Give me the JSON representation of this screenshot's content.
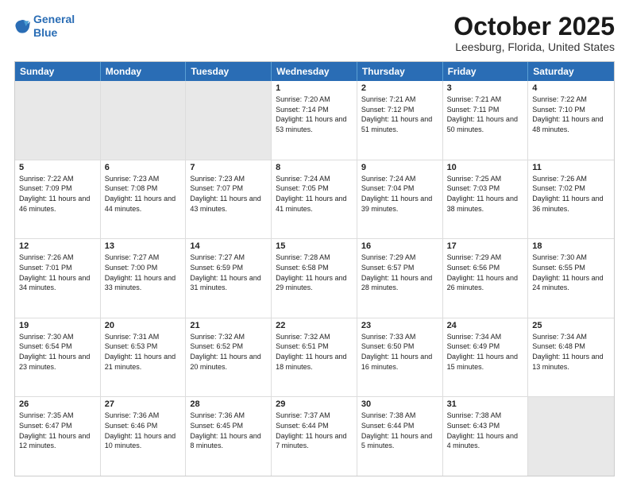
{
  "logo": {
    "line1": "General",
    "line2": "Blue"
  },
  "title": "October 2025",
  "location": "Leesburg, Florida, United States",
  "days_of_week": [
    "Sunday",
    "Monday",
    "Tuesday",
    "Wednesday",
    "Thursday",
    "Friday",
    "Saturday"
  ],
  "rows": [
    [
      {
        "day": "",
        "text": ""
      },
      {
        "day": "",
        "text": ""
      },
      {
        "day": "",
        "text": ""
      },
      {
        "day": "1",
        "text": "Sunrise: 7:20 AM\nSunset: 7:14 PM\nDaylight: 11 hours and 53 minutes."
      },
      {
        "day": "2",
        "text": "Sunrise: 7:21 AM\nSunset: 7:12 PM\nDaylight: 11 hours and 51 minutes."
      },
      {
        "day": "3",
        "text": "Sunrise: 7:21 AM\nSunset: 7:11 PM\nDaylight: 11 hours and 50 minutes."
      },
      {
        "day": "4",
        "text": "Sunrise: 7:22 AM\nSunset: 7:10 PM\nDaylight: 11 hours and 48 minutes."
      }
    ],
    [
      {
        "day": "5",
        "text": "Sunrise: 7:22 AM\nSunset: 7:09 PM\nDaylight: 11 hours and 46 minutes."
      },
      {
        "day": "6",
        "text": "Sunrise: 7:23 AM\nSunset: 7:08 PM\nDaylight: 11 hours and 44 minutes."
      },
      {
        "day": "7",
        "text": "Sunrise: 7:23 AM\nSunset: 7:07 PM\nDaylight: 11 hours and 43 minutes."
      },
      {
        "day": "8",
        "text": "Sunrise: 7:24 AM\nSunset: 7:05 PM\nDaylight: 11 hours and 41 minutes."
      },
      {
        "day": "9",
        "text": "Sunrise: 7:24 AM\nSunset: 7:04 PM\nDaylight: 11 hours and 39 minutes."
      },
      {
        "day": "10",
        "text": "Sunrise: 7:25 AM\nSunset: 7:03 PM\nDaylight: 11 hours and 38 minutes."
      },
      {
        "day": "11",
        "text": "Sunrise: 7:26 AM\nSunset: 7:02 PM\nDaylight: 11 hours and 36 minutes."
      }
    ],
    [
      {
        "day": "12",
        "text": "Sunrise: 7:26 AM\nSunset: 7:01 PM\nDaylight: 11 hours and 34 minutes."
      },
      {
        "day": "13",
        "text": "Sunrise: 7:27 AM\nSunset: 7:00 PM\nDaylight: 11 hours and 33 minutes."
      },
      {
        "day": "14",
        "text": "Sunrise: 7:27 AM\nSunset: 6:59 PM\nDaylight: 11 hours and 31 minutes."
      },
      {
        "day": "15",
        "text": "Sunrise: 7:28 AM\nSunset: 6:58 PM\nDaylight: 11 hours and 29 minutes."
      },
      {
        "day": "16",
        "text": "Sunrise: 7:29 AM\nSunset: 6:57 PM\nDaylight: 11 hours and 28 minutes."
      },
      {
        "day": "17",
        "text": "Sunrise: 7:29 AM\nSunset: 6:56 PM\nDaylight: 11 hours and 26 minutes."
      },
      {
        "day": "18",
        "text": "Sunrise: 7:30 AM\nSunset: 6:55 PM\nDaylight: 11 hours and 24 minutes."
      }
    ],
    [
      {
        "day": "19",
        "text": "Sunrise: 7:30 AM\nSunset: 6:54 PM\nDaylight: 11 hours and 23 minutes."
      },
      {
        "day": "20",
        "text": "Sunrise: 7:31 AM\nSunset: 6:53 PM\nDaylight: 11 hours and 21 minutes."
      },
      {
        "day": "21",
        "text": "Sunrise: 7:32 AM\nSunset: 6:52 PM\nDaylight: 11 hours and 20 minutes."
      },
      {
        "day": "22",
        "text": "Sunrise: 7:32 AM\nSunset: 6:51 PM\nDaylight: 11 hours and 18 minutes."
      },
      {
        "day": "23",
        "text": "Sunrise: 7:33 AM\nSunset: 6:50 PM\nDaylight: 11 hours and 16 minutes."
      },
      {
        "day": "24",
        "text": "Sunrise: 7:34 AM\nSunset: 6:49 PM\nDaylight: 11 hours and 15 minutes."
      },
      {
        "day": "25",
        "text": "Sunrise: 7:34 AM\nSunset: 6:48 PM\nDaylight: 11 hours and 13 minutes."
      }
    ],
    [
      {
        "day": "26",
        "text": "Sunrise: 7:35 AM\nSunset: 6:47 PM\nDaylight: 11 hours and 12 minutes."
      },
      {
        "day": "27",
        "text": "Sunrise: 7:36 AM\nSunset: 6:46 PM\nDaylight: 11 hours and 10 minutes."
      },
      {
        "day": "28",
        "text": "Sunrise: 7:36 AM\nSunset: 6:45 PM\nDaylight: 11 hours and 8 minutes."
      },
      {
        "day": "29",
        "text": "Sunrise: 7:37 AM\nSunset: 6:44 PM\nDaylight: 11 hours and 7 minutes."
      },
      {
        "day": "30",
        "text": "Sunrise: 7:38 AM\nSunset: 6:44 PM\nDaylight: 11 hours and 5 minutes."
      },
      {
        "day": "31",
        "text": "Sunrise: 7:38 AM\nSunset: 6:43 PM\nDaylight: 11 hours and 4 minutes."
      },
      {
        "day": "",
        "text": ""
      }
    ]
  ]
}
